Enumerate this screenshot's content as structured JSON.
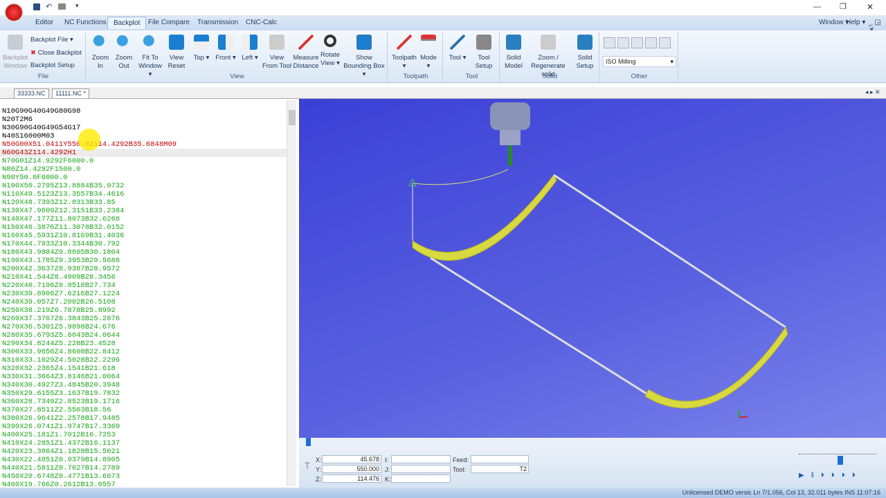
{
  "titlebar": {
    "window_controls": [
      "—",
      "❐",
      "✕"
    ]
  },
  "menu_tabs": [
    "Editor",
    "NC Functions",
    "Backplot",
    "File Compare",
    "Transmission",
    "CNC-Calc"
  ],
  "menu_right": {
    "window": "Window ▾",
    "help": "Help ▾",
    "controls": "_ ◲ ✕"
  },
  "ribbon": {
    "file": {
      "label": "File",
      "window_btn": "Backplot Window",
      "backplot_file": "Backplot File ▾",
      "close_backplot": "Close Backplot",
      "backplot_setup": "Backplot Setup"
    },
    "view": {
      "label": "View",
      "buttons": [
        "Zoom In",
        "Zoom Out",
        "Fit To Window ▾",
        "View Reset",
        "Top ▾",
        "Front ▾",
        "Left ▾",
        "View From Tool",
        "Measure Distance",
        "Rotate View ▾",
        "Show Bounding Box ▾"
      ]
    },
    "toolpath": {
      "label": "Toolpath",
      "buttons": [
        "Toolpath ▾",
        "Mode ▾"
      ]
    },
    "tool": {
      "label": "Tool",
      "buttons": [
        "Tool ▾",
        "Tool Setup"
      ]
    },
    "solid": {
      "label": "Solid",
      "buttons": [
        "Solid Model",
        "Zoom / Regenerate solid",
        "Solid Setup"
      ]
    },
    "other": {
      "label": "Other",
      "select": "ISO Milling"
    }
  },
  "doc_tabs": [
    "33333.NC",
    "11111.NC *"
  ],
  "editor": {
    "lines": [
      {
        "t": "N10G90G40G49G80G98",
        "c": "#000"
      },
      {
        "t": "N20T2M6",
        "c": "#000"
      },
      {
        "t": "N30G90G40G49G54G17",
        "c": "#000"
      },
      {
        "t": "N40S16000M03",
        "c": "#000"
      },
      {
        "t": "N50G00X51.0411Y550.0Z114.4292B35.6848M09",
        "c": "#c00000"
      },
      {
        "t": "N60G43Z114.4292H1",
        "c": "#c00000"
      },
      {
        "t": "N70G01Z14.9292F6000.0",
        "c": "#1aa51a"
      },
      {
        "t": "N80Z14.4292F1500.0",
        "c": "#1aa51a"
      },
      {
        "t": "N90Y50.0F6000.0",
        "c": "#1aa51a"
      },
      {
        "t": "N100X50.2795Z13.8884B35.0732",
        "c": "#1aa51a"
      },
      {
        "t": "N110X49.5123Z13.3557B34.4616",
        "c": "#1aa51a"
      },
      {
        "t": "N120X48.7393Z12.8313B33.85",
        "c": "#1aa51a"
      },
      {
        "t": "N130X47.9609Z12.3151B33.2384",
        "c": "#1aa51a"
      },
      {
        "t": "N140X47.177Z11.8073B32.6268",
        "c": "#1aa51a"
      },
      {
        "t": "N150X46.3876Z11.3078B32.0152",
        "c": "#1aa51a"
      },
      {
        "t": "N160X45.5931Z10.8169B31.4036",
        "c": "#1aa51a"
      },
      {
        "t": "N170X44.7933Z10.3344B30.792",
        "c": "#1aa51a"
      },
      {
        "t": "N180X43.9884Z9.8605B30.1804",
        "c": "#1aa51a"
      },
      {
        "t": "N190X43.1785Z9.3953B29.5688",
        "c": "#1aa51a"
      },
      {
        "t": "N200X42.3637Z8.9387B28.9572",
        "c": "#1aa51a"
      },
      {
        "t": "N210X41.544Z8.4909B28.3456",
        "c": "#1aa51a"
      },
      {
        "t": "N220X40.7196Z8.0518B27.734",
        "c": "#1aa51a"
      },
      {
        "t": "N230X39.8906Z7.6216B27.1224",
        "c": "#1aa51a"
      },
      {
        "t": "N240X39.057Z7.2002B26.5108",
        "c": "#1aa51a"
      },
      {
        "t": "N250X38.219Z6.7878B25.8992",
        "c": "#1aa51a"
      },
      {
        "t": "N260X37.3767Z6.3843B25.2876",
        "c": "#1aa51a"
      },
      {
        "t": "N270X36.5301Z5.9898B24.676",
        "c": "#1aa51a"
      },
      {
        "t": "N280X35.6793Z5.6043B24.0644",
        "c": "#1aa51a"
      },
      {
        "t": "N290X34.8244Z5.228B23.4528",
        "c": "#1aa51a"
      },
      {
        "t": "N300X33.9656Z4.8608B22.8412",
        "c": "#1aa51a"
      },
      {
        "t": "N310X33.1029Z4.5028B22.2296",
        "c": "#1aa51a"
      },
      {
        "t": "N320X32.2365Z4.1541B21.618",
        "c": "#1aa51a"
      },
      {
        "t": "N330X31.3664Z3.8146B21.0064",
        "c": "#1aa51a"
      },
      {
        "t": "N340X30.4927Z3.4845B20.3948",
        "c": "#1aa51a"
      },
      {
        "t": "N350X29.6155Z3.1637B19.7832",
        "c": "#1aa51a"
      },
      {
        "t": "N360X28.7349Z2.8523B19.1716",
        "c": "#1aa51a"
      },
      {
        "t": "N370X27.8511Z2.5503B18.56",
        "c": "#1aa51a"
      },
      {
        "t": "N380X26.9641Z2.2578B17.9485",
        "c": "#1aa51a"
      },
      {
        "t": "N390X26.0741Z1.9747B17.3369",
        "c": "#1aa51a"
      },
      {
        "t": "N400X25.181Z1.7012B16.7253",
        "c": "#1aa51a"
      },
      {
        "t": "N410X24.2851Z1.4372B16.1137",
        "c": "#1aa51a"
      },
      {
        "t": "N420X23.3864Z1.1828B15.5021",
        "c": "#1aa51a"
      },
      {
        "t": "N430X22.4851Z0.9379B14.8905",
        "c": "#1aa51a"
      },
      {
        "t": "N440X21.5811Z0.7027B14.2789",
        "c": "#1aa51a"
      },
      {
        "t": "N450X20.6748Z0.4771B13.6673",
        "c": "#1aa51a"
      },
      {
        "t": "N460X19.766Z0.2612B13.0557",
        "c": "#1aa51a"
      }
    ],
    "current_line": 6
  },
  "coords": {
    "x_label": "X:",
    "x": "45.678",
    "y_label": "Y:",
    "y": "550.000",
    "z_label": "Z:",
    "z": "114.476",
    "i_label": "I:",
    "j_label": "J:",
    "k_label": "K:",
    "feed_label": "Feed:",
    "feed": "",
    "tool_label": "Tool:",
    "tool": "T2"
  },
  "playback": {
    "progress": 0.0,
    "speed": 0.5
  },
  "status": "Unlicensed DEMO versic Ln 7/1.056, Col 13, 32.011 bytes   INS   11:07:16"
}
